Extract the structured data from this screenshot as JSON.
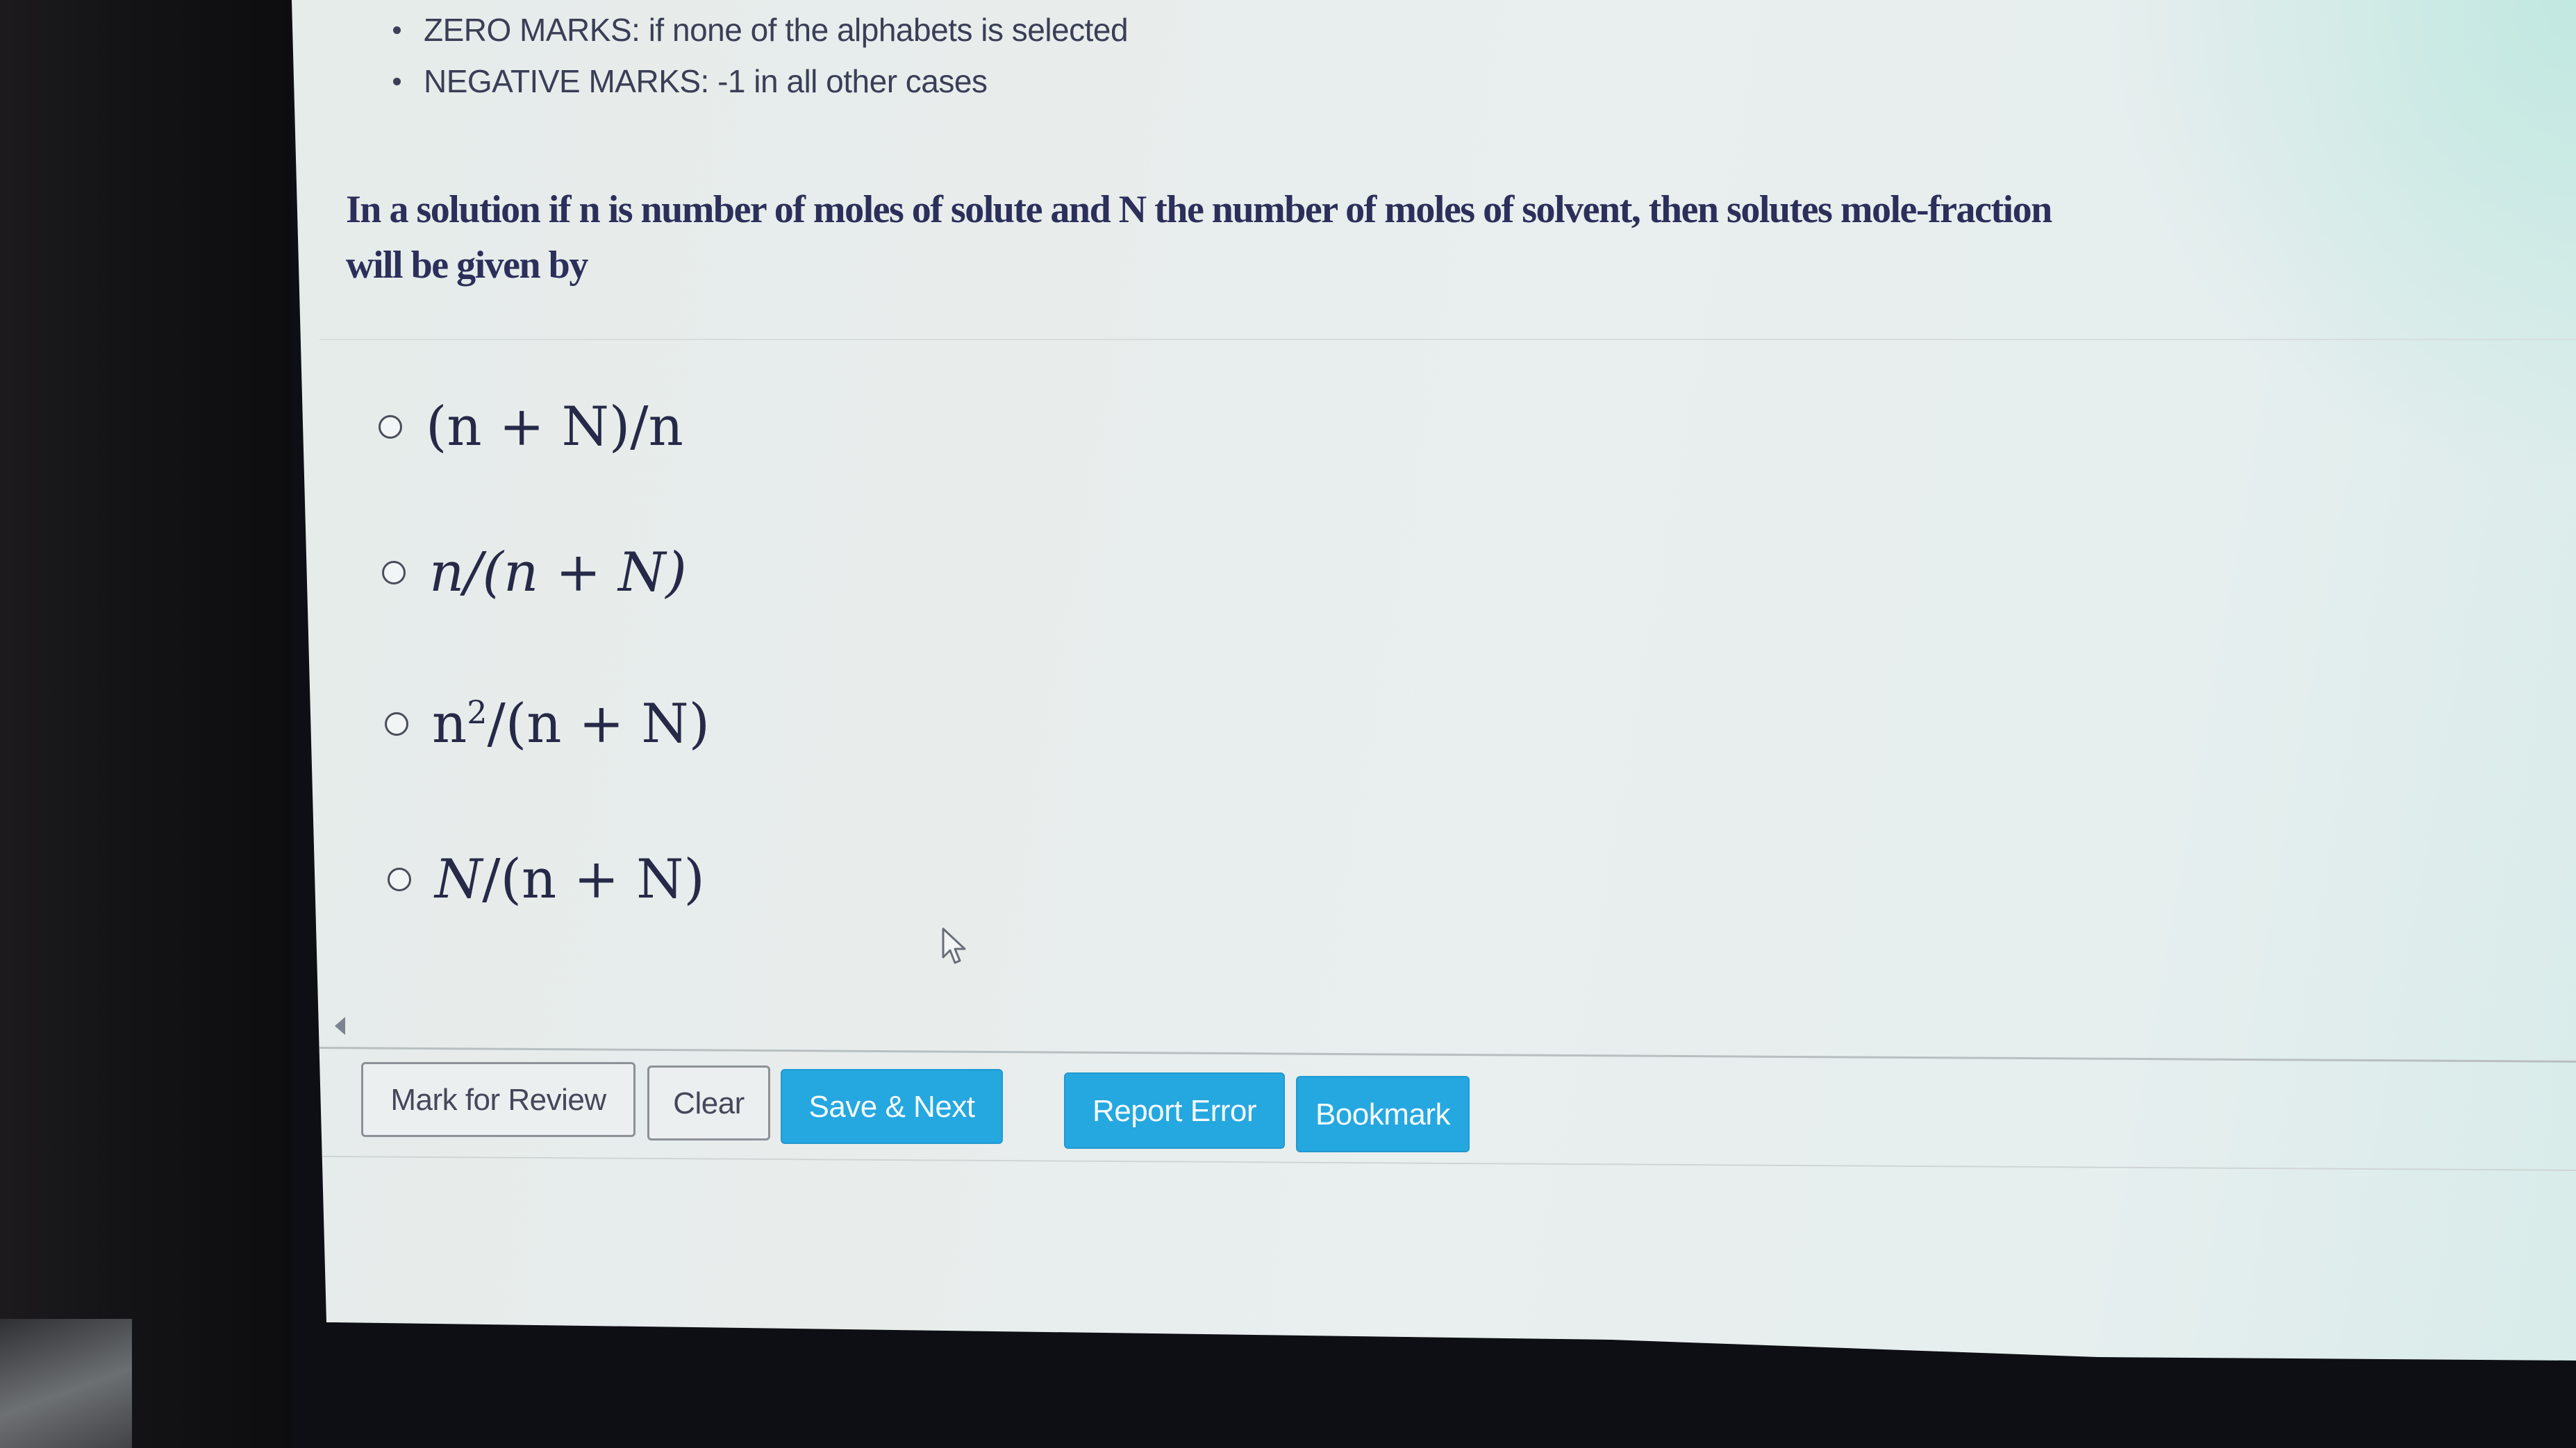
{
  "instructions": {
    "rules": [
      "ZERO MARKS: if none of the alphabets is selected",
      "NEGATIVE MARKS: -1 in all other cases"
    ]
  },
  "question": {
    "text": "In a solution if n is number of moles of solute and N the number of moles of solvent, then solutes mole-fraction will be given by",
    "options": [
      {
        "id": "A",
        "label": "(n + N)/n",
        "selected": false
      },
      {
        "id": "B",
        "label": "n/(n + N)",
        "selected": false
      },
      {
        "id": "C",
        "label_base": "n",
        "label_sup": "2",
        "label_rest": "/(n + N)",
        "label": "n²/(n + N)",
        "selected": false
      },
      {
        "id": "D",
        "label_italic": "N",
        "label_rest": "/(n + N)",
        "label": "N/(n + N)",
        "selected": false
      }
    ]
  },
  "actions": {
    "mark_for_review": "Mark for Review",
    "clear": "Clear",
    "save_next": "Save & Next",
    "report_error": "Report Error",
    "bookmark": "Bookmark"
  },
  "icons": {
    "nav_arrow": "triangle-left",
    "cursor": "mouse-pointer"
  },
  "colors": {
    "primary_button": "#25a7e0",
    "text": "#2c2f5a"
  }
}
